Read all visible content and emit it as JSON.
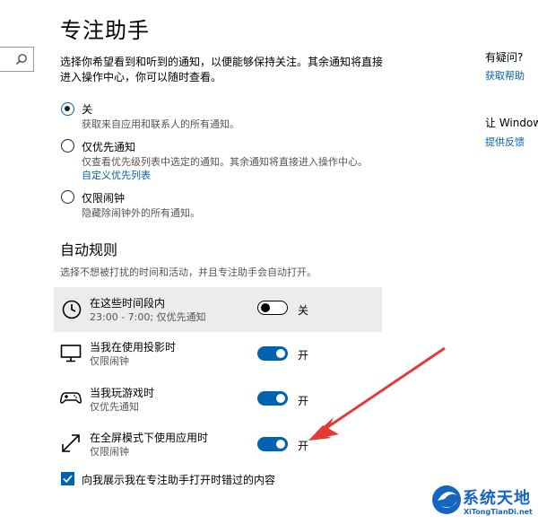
{
  "header": {
    "title": "专注助手",
    "description": "选择你希望看到和听到的通知，以便能够保持关注。其余通知将直接进入操作中心，你可以随时查看。"
  },
  "modes": [
    {
      "label": "关",
      "sub": "获取来自应用和联系人的所有通知。",
      "checked": true
    },
    {
      "label": "仅优先通知",
      "sub": "仅查看优先级列表中选定的通知。其余通知将直接进入操作中心。",
      "link": "自定义优先列表",
      "checked": false
    },
    {
      "label": "仅限闹钟",
      "sub": "隐藏除闹钟外的所有通知。",
      "checked": false
    }
  ],
  "auto_rules": {
    "title": "自动规则",
    "description": "选择不想被打扰的时间和活动，并且专注助手会自动打开。",
    "rules": [
      {
        "title": "在这些时间段内",
        "sub": "23:00 - 7:00; 仅优先通知",
        "icon": "clock-icon",
        "on": false,
        "state": "关"
      },
      {
        "title": "当我在使用投影时",
        "sub": "仅限闹钟",
        "icon": "monitor-icon",
        "on": true,
        "state": "开"
      },
      {
        "title": "当我玩游戏时",
        "sub": "仅优先通知",
        "icon": "gamepad-icon",
        "on": true,
        "state": "开"
      },
      {
        "title": "在全屏模式下使用应用时",
        "sub": "仅限闹钟",
        "icon": "fullscreen-icon",
        "on": true,
        "state": "开"
      }
    ]
  },
  "checkbox": {
    "label": "向我展示我在专注助手打开时错过的内容",
    "checked": true
  },
  "sidebar_right": {
    "question": "有疑问?",
    "help_link": "获取帮助",
    "improve": "让 Windows",
    "feedback_link": "提供反馈"
  },
  "watermark": {
    "name": "系统天地",
    "url": "XiTongTianDi.net"
  },
  "colors": {
    "accent": "#0063b1",
    "annotation_arrow": "#e53935"
  }
}
